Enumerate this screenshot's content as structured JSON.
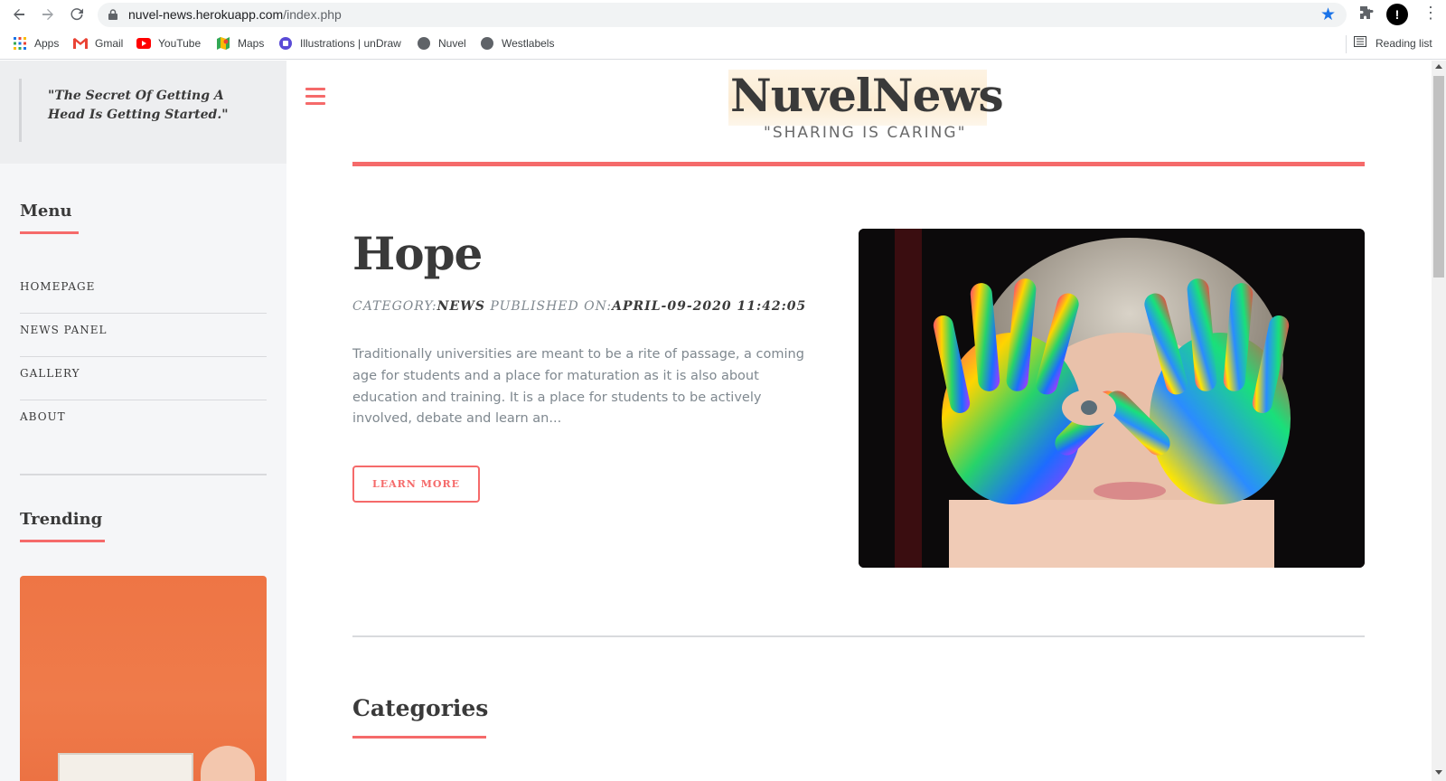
{
  "browser": {
    "url_host": "nuvel-news.herokuapp.com",
    "url_path": "/index.php",
    "bookmarks": [
      {
        "label": "Apps",
        "icon": "apps-grid-icon"
      },
      {
        "label": "Gmail",
        "icon": "gmail-icon"
      },
      {
        "label": "YouTube",
        "icon": "youtube-icon"
      },
      {
        "label": "Maps",
        "icon": "maps-icon"
      },
      {
        "label": "Illustrations | unDraw",
        "icon": "undraw-icon"
      },
      {
        "label": "Nuvel",
        "icon": "globe-icon"
      },
      {
        "label": "Westlabels",
        "icon": "globe-icon"
      }
    ],
    "reading_list": "Reading list",
    "profile_initial": "!"
  },
  "sidebar": {
    "quote": "\"The Secret Of Getting A Head Is Getting Started.\"",
    "menu_heading": "Menu",
    "menu_items": [
      "HOMEPAGE",
      "NEWS PANEL",
      "GALLERY",
      "ABOUT"
    ],
    "trending_heading": "Trending"
  },
  "header": {
    "logo": "NuvelNews",
    "tagline": "\"SHARING IS CARING\""
  },
  "article": {
    "title": "Hope",
    "category_label": "CATEGORY:",
    "category": "NEWS",
    "published_label": "PUBLISHED ON:",
    "published": "APRIL-09-2020 11:42:05",
    "excerpt": "Traditionally universities are meant to be a rite of passage, a coming age for students and a place for maturation as it is also about education and training. It is a place for students to be actively involved, debate and learn an...",
    "button": "LEARN MORE"
  },
  "categories_heading": "Categories",
  "colors": {
    "accent": "#f56a6a",
    "text": "#3a3a3a",
    "muted": "#7f888f",
    "sidebar_bg": "#f5f6f8"
  }
}
